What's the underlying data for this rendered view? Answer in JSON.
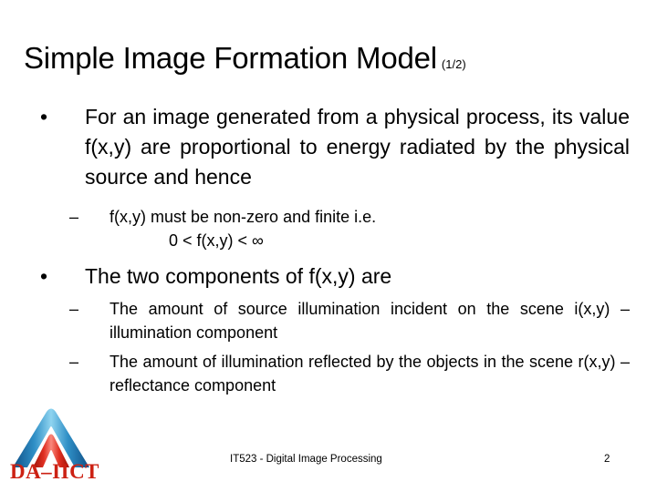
{
  "slide": {
    "title": "Simple Image Formation Model",
    "title_suffix": "(1/2)",
    "bullets": [
      {
        "level": 1,
        "marker": "•",
        "text": "For an image generated from a physical process, its value f(x,y) are proportional to energy radiated by the physical source and hence"
      },
      {
        "level": 2,
        "marker": "–",
        "text": "f(x,y) must be non-zero and finite i.e."
      },
      {
        "level": 0,
        "marker": "",
        "text": "0 < f(x,y) < ∞"
      },
      {
        "level": 1,
        "marker": "•",
        "text": "The two components of f(x,y) are"
      },
      {
        "level": 2,
        "marker": "–",
        "text": "The amount of source illumination incident on the scene i(x,y) – illumination component"
      },
      {
        "level": 2,
        "marker": "–",
        "text": "The amount of illumination reflected by the objects in the scene r(x,y) – reflectance component"
      }
    ]
  },
  "footer": {
    "center_text": "IT523 - Digital Image Processing",
    "page_number": "2"
  },
  "logo": {
    "wordmark": "DA–IICT",
    "outer_color": "#1b6fae",
    "outer_highlight": "#6fc3e8",
    "inner_color": "#cf2018",
    "inner_highlight": "#f4766a",
    "text_color": "#cc2113"
  }
}
